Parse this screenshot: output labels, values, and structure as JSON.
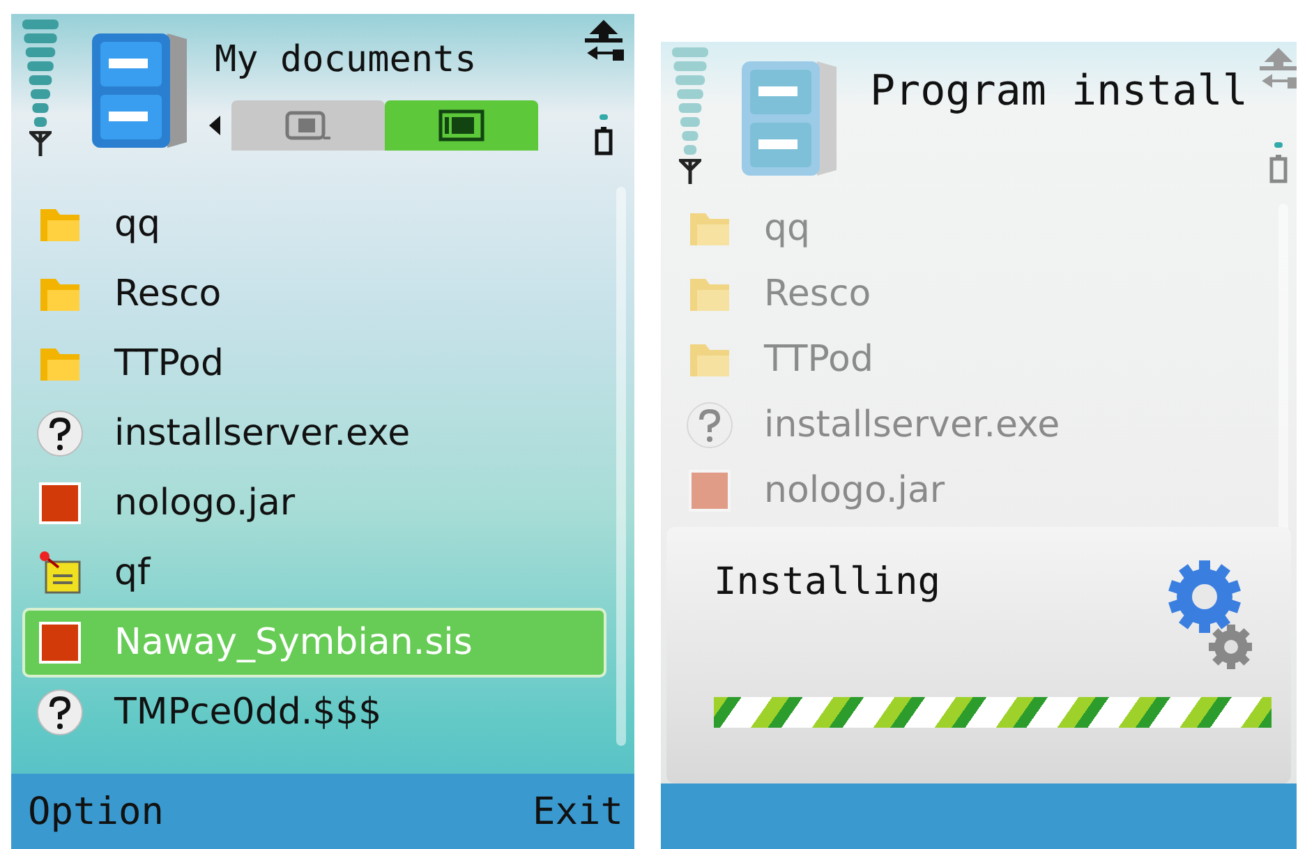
{
  "screens": [
    {
      "title": "My documents",
      "dimmed": false,
      "tabs": [
        {
          "kind": "phone",
          "selected": false
        },
        {
          "kind": "card",
          "selected": true
        }
      ],
      "files": [
        {
          "name": "qq",
          "kind": "folder",
          "selected": false
        },
        {
          "name": "Resco",
          "kind": "folder",
          "selected": false
        },
        {
          "name": "TTPod",
          "kind": "folder",
          "selected": false
        },
        {
          "name": "installserver.exe",
          "kind": "unknown",
          "selected": false
        },
        {
          "name": "nologo.jar",
          "kind": "app",
          "selected": false
        },
        {
          "name": "qf",
          "kind": "note",
          "selected": false
        },
        {
          "name": "Naway_Symbian.sis",
          "kind": "app",
          "selected": true
        },
        {
          "name": "TMPce0dd.$$$",
          "kind": "unknown",
          "selected": false
        }
      ],
      "softkeys": [
        "Option",
        "Exit"
      ]
    },
    {
      "title": "Program install",
      "dimmed": true,
      "files": [
        {
          "name": "qq",
          "kind": "folder",
          "selected": false
        },
        {
          "name": "Resco",
          "kind": "folder",
          "selected": false
        },
        {
          "name": "TTPod",
          "kind": "folder",
          "selected": false
        },
        {
          "name": "installserver.exe",
          "kind": "unknown",
          "selected": false
        },
        {
          "name": "nologo.jar",
          "kind": "app",
          "selected": false
        }
      ],
      "dialog": {
        "text": "Installing",
        "level": 1
      }
    }
  ]
}
